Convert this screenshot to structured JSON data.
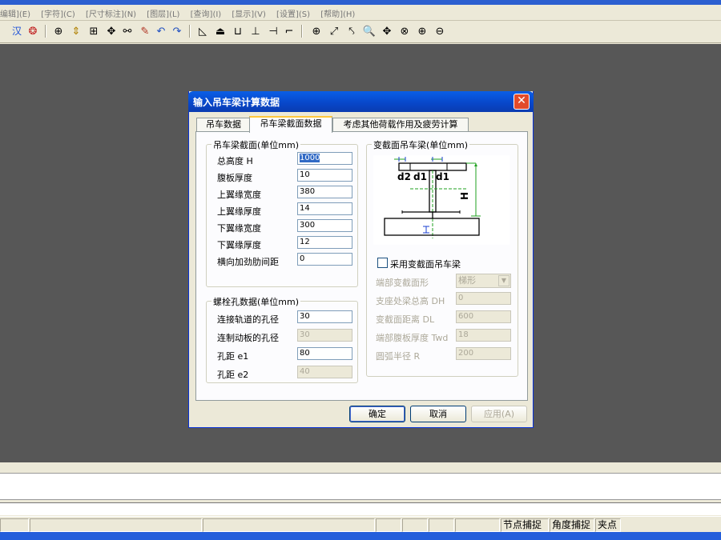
{
  "menu": {
    "items": [
      "编辑](E)",
      "[字符](C)",
      "[尺寸标注](N)",
      "[图层](L)",
      "[查询](I)",
      "[显示](V)",
      "[设置](S)",
      "[帮助](H)"
    ]
  },
  "toolbar": {
    "icons": [
      "汉",
      "⊕",
      "⇕",
      "⊞",
      "✥",
      "⚯",
      "✎",
      "↶",
      "↷",
      "◺",
      "⏏",
      "⊔",
      "⊥",
      "⊣",
      "⌐",
      "⊕",
      "⤢",
      "⤣",
      "🔍",
      "✥",
      "⊗",
      "⊕",
      "⊖"
    ]
  },
  "dialog": {
    "title": "输入吊车梁计算数据",
    "close": "✕",
    "tabs": [
      "吊车数据",
      "吊车梁截面数据",
      "考虑其他荷载作用及疲劳计算"
    ],
    "section_group": {
      "title": "吊车梁截面(单位mm)",
      "fields": [
        {
          "label": "总高度 H",
          "value": "1000",
          "selected": true
        },
        {
          "label": "腹板厚度",
          "value": "10"
        },
        {
          "label": "上翼缘宽度",
          "value": "380"
        },
        {
          "label": "上翼缘厚度",
          "value": "14"
        },
        {
          "label": "下翼缘宽度",
          "value": "300"
        },
        {
          "label": "下翼缘厚度",
          "value": "12"
        },
        {
          "label": "横向加劲肋间距",
          "value": "0"
        }
      ]
    },
    "bolt_group": {
      "title": "螺栓孔数据(单位mm)",
      "fields": [
        {
          "label": "连接轨道的孔径",
          "value": "30",
          "disabled": false
        },
        {
          "label": "连制动板的孔径",
          "value": "30",
          "disabled": true
        },
        {
          "label": "孔距 e1",
          "value": "80",
          "disabled": false
        },
        {
          "label": "孔距 e2",
          "value": "40",
          "disabled": true
        }
      ]
    },
    "variable_group": {
      "title": "变截面吊车梁(单位mm)",
      "diagram_labels": {
        "d2": "d2",
        "d1a": "d1",
        "d1b": "d1",
        "H": "H"
      },
      "checkbox_label": "采用变截面吊车梁",
      "checkbox_checked": false,
      "end_shape_label": "端部变截面形",
      "end_shape_value": "梯形",
      "fields": [
        {
          "label": "支座处梁总高 DH",
          "value": "0"
        },
        {
          "label": "变截面距离 DL",
          "value": "600"
        },
        {
          "label": "端部腹板厚度 Twd",
          "value": "18"
        },
        {
          "label": "圆弧半径 R",
          "value": "200"
        }
      ]
    },
    "buttons": {
      "ok": "确定",
      "cancel": "取消",
      "apply": "应用(A)"
    }
  },
  "statusbar": {
    "node_snap": "节点捕捉",
    "angle_snap": "角度捕捉",
    "clip_point": "夹点"
  }
}
